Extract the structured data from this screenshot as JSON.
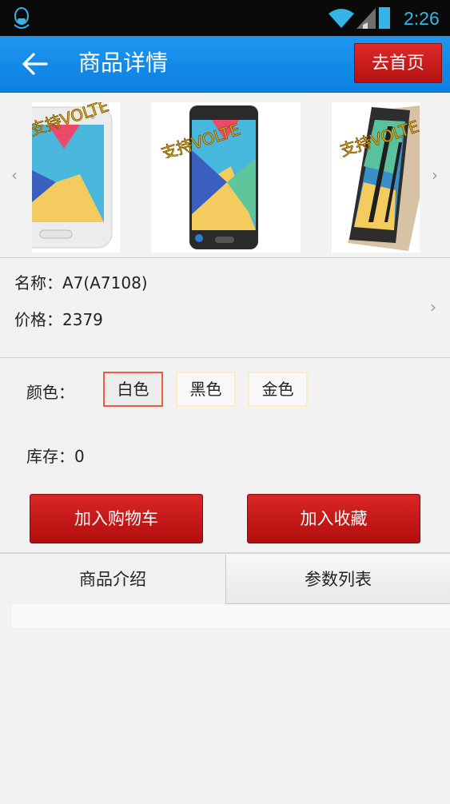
{
  "status_bar": {
    "time": "2:26"
  },
  "header": {
    "title": "商品详情",
    "home_button": "去首页"
  },
  "gallery": {
    "badge_text": "支持VOLTE"
  },
  "product": {
    "name": "名称：A7(A7108)",
    "price": "价格：2379"
  },
  "options": {
    "color_label": "颜色：",
    "colors": [
      "白色",
      "黑色",
      "金色"
    ],
    "selected_color": "白色",
    "stock": "库存：0"
  },
  "actions": {
    "add_to_cart": "加入购物车",
    "add_favorite": "加入收藏"
  },
  "tabs": [
    {
      "label": "商品介绍"
    },
    {
      "label": "参数列表"
    }
  ],
  "colors": {
    "title_bar": "#1f97f1",
    "accent_red": "#c81a1a",
    "selected_border": "#e95b45",
    "status_icons": "#35b5e5"
  }
}
